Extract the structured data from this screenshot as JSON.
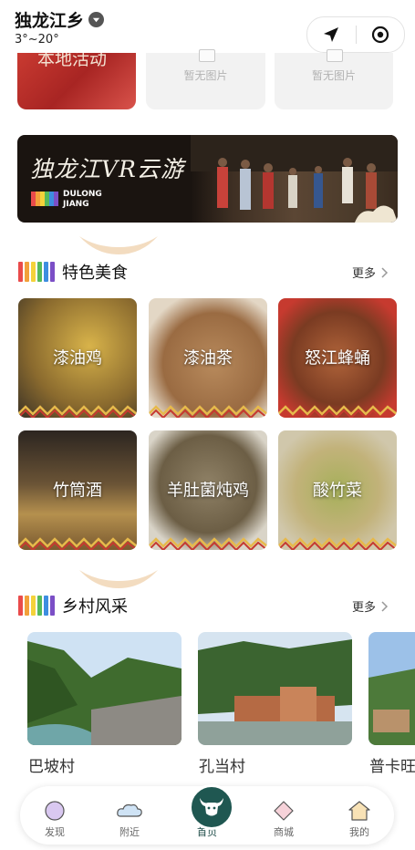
{
  "header": {
    "title": "独龙江乡",
    "temperature": "3°~20°",
    "location_icon": "location-arrow-icon",
    "target_icon": "target-icon"
  },
  "top_cards": [
    {
      "text": "本地活动"
    },
    {
      "text": "暂无图片"
    },
    {
      "text": "暂无图片"
    }
  ],
  "banner": {
    "title": "独龙江VR云游",
    "sub1": "DULONG",
    "sub2": "JIANG"
  },
  "food_section": {
    "title": "特色美食",
    "more": "更多",
    "items": [
      {
        "label": "漆油鸡"
      },
      {
        "label": "漆油茶"
      },
      {
        "label": "怒江蜂蛹"
      },
      {
        "label": "竹筒酒"
      },
      {
        "label": "羊肚菌炖鸡"
      },
      {
        "label": "酸竹菜"
      }
    ]
  },
  "village_section": {
    "title": "乡村风采",
    "more": "更多",
    "items": [
      {
        "name": "巴坡村"
      },
      {
        "name": "孔当村"
      },
      {
        "name": "普卡旺"
      }
    ]
  },
  "tabbar": {
    "items": [
      {
        "label": "发现",
        "icon": "discover-icon"
      },
      {
        "label": "附近",
        "icon": "nearby-cloud-icon"
      },
      {
        "label": "首页",
        "icon": "home-ox-icon"
      },
      {
        "label": "商城",
        "icon": "mall-icon"
      },
      {
        "label": "我的",
        "icon": "profile-house-icon"
      }
    ],
    "active": "首页"
  },
  "colors": {
    "brand_teal": "#1f5751",
    "rainbow": [
      "#e94b4b",
      "#f2a03a",
      "#f4d23a",
      "#56b95b",
      "#3d8ee0",
      "#7b4fc6"
    ]
  }
}
